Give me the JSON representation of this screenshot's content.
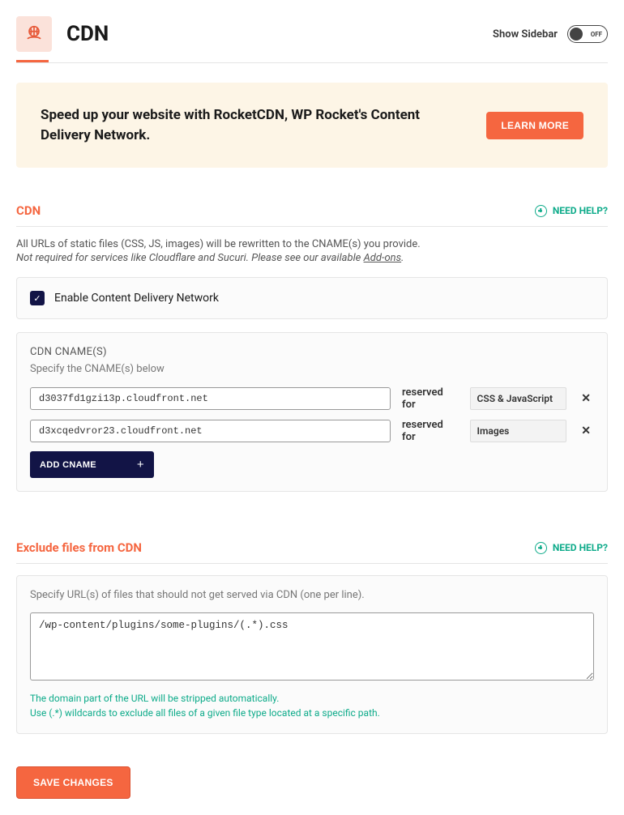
{
  "header": {
    "title": "CDN",
    "show_sidebar_label": "Show Sidebar",
    "toggle_state": "OFF"
  },
  "promo": {
    "text": "Speed up your website with RocketCDN, WP Rocket's Content Delivery Network.",
    "button": "LEARN MORE"
  },
  "cdn_section": {
    "title": "CDN",
    "help": "NEED HELP?",
    "desc": "All URLs of static files (CSS, JS, images) will be rewritten to the CNAME(s) you provide.",
    "note_prefix": "Not required for services like Cloudflare and Sucuri. Please see our available ",
    "note_link": "Add-ons",
    "note_suffix": ".",
    "enable_label": "Enable Content Delivery Network",
    "cnames_title": "CDN CNAME(S)",
    "cnames_desc": "Specify the CNAME(s) below",
    "reserved_label": "reserved for",
    "rows": [
      {
        "value": "d3037fd1gzi13p.cloudfront.net",
        "zone": "CSS & JavaScript"
      },
      {
        "value": "d3xcqedvror23.cloudfront.net",
        "zone": "Images"
      }
    ],
    "add_label": "ADD CNAME"
  },
  "exclude_section": {
    "title": "Exclude files from CDN",
    "help": "NEED HELP?",
    "desc": "Specify URL(s) of files that should not get served via CDN (one per line).",
    "value": "/wp-content/plugins/some-plugins/(.*).css",
    "hint1": "The domain part of the URL will be stripped automatically.",
    "hint2": "Use (.*) wildcards to exclude all files of a given file type located at a specific path."
  },
  "save": {
    "label": "SAVE CHANGES"
  }
}
